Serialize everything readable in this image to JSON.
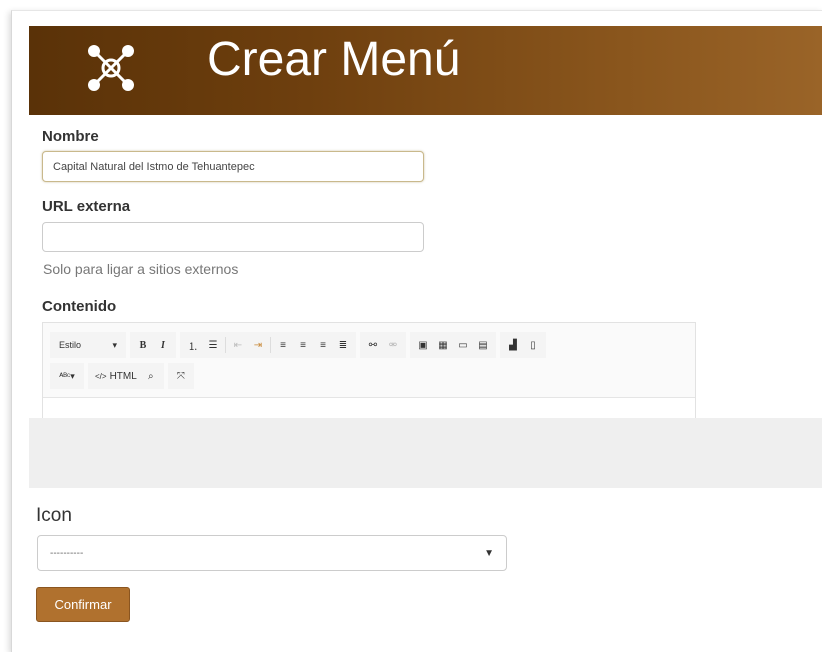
{
  "header": {
    "title": "Crear Menú",
    "logo_icon": "molecule-icon"
  },
  "form": {
    "nombre_label": "Nombre",
    "nombre_value": "Capital Natural del Istmo de Tehuantepec",
    "url_label": "URL externa",
    "url_value": "",
    "url_help": "Solo para ligar a sitios externos",
    "contenido_label": "Contenido",
    "icon_label": "Icon",
    "icon_selected": "----------",
    "confirm_label": "Confirmar"
  },
  "editor": {
    "style_label": "Estilo",
    "html_label": "HTML"
  },
  "colors": {
    "header_start": "#5a3208",
    "header_end": "#9a6428",
    "button": "#b0712e"
  }
}
